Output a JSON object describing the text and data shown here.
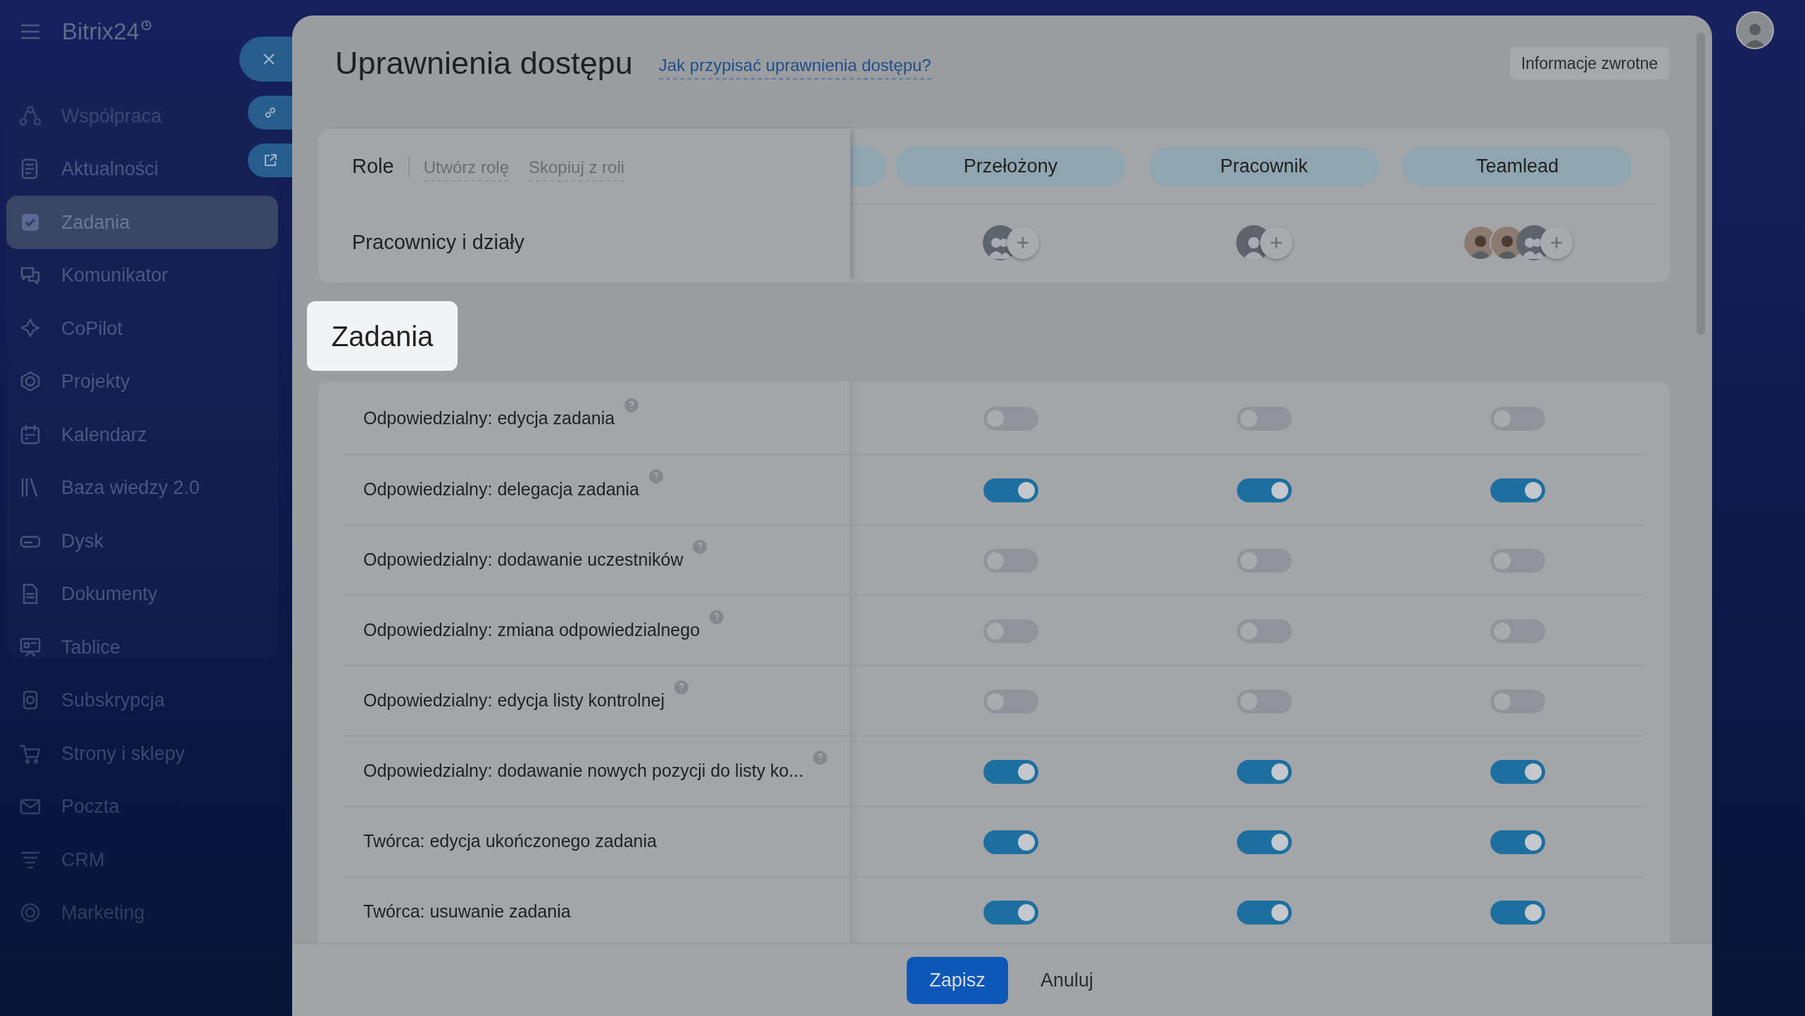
{
  "sidebar": {
    "logo": "Bitrix24",
    "items": [
      {
        "label": "Współpraca",
        "selected": false
      },
      {
        "label": "Aktualności",
        "selected": false
      },
      {
        "label": "Zadania",
        "selected": true
      },
      {
        "label": "Komunikator",
        "selected": false
      },
      {
        "label": "CoPilot",
        "selected": false
      },
      {
        "label": "Projekty",
        "selected": false
      },
      {
        "label": "Kalendarz",
        "selected": false
      },
      {
        "label": "Baza wiedzy 2.0",
        "selected": false
      },
      {
        "label": "Dysk",
        "selected": false
      },
      {
        "label": "Dokumenty",
        "selected": false
      },
      {
        "label": "Tablice",
        "selected": false
      },
      {
        "label": "Subskrypcja",
        "selected": false
      },
      {
        "label": "Strony i sklepy",
        "selected": false
      },
      {
        "label": "Poczta",
        "selected": false
      },
      {
        "label": "CRM",
        "selected": false
      },
      {
        "label": "Marketing",
        "selected": false
      }
    ]
  },
  "modal": {
    "title": "Uprawnienia dostępu",
    "help_link": "Jak przypisać uprawnienia dostępu?",
    "feedback_button": "Informacje zwrotne",
    "roles": {
      "label": "Role",
      "actions": [
        "Utwórz rolę",
        "Skopiuj z roli"
      ],
      "members_label": "Pracownicy i działy",
      "columns": [
        {
          "name": "Przełożony",
          "members": [
            {
              "kind": "group"
            }
          ]
        },
        {
          "name": "Pracownik",
          "members": [
            {
              "kind": "person"
            }
          ]
        },
        {
          "name": "Teamlead",
          "members": [
            {
              "kind": "photo"
            },
            {
              "kind": "photo"
            },
            {
              "kind": "group"
            }
          ]
        }
      ]
    },
    "section": {
      "title": "Zadania",
      "rows": [
        {
          "label": "Odpowiedzialny: edycja zadania",
          "help": true,
          "on": [
            false,
            false,
            false
          ]
        },
        {
          "label": "Odpowiedzialny: delegacja zadania",
          "help": true,
          "on": [
            true,
            true,
            true
          ]
        },
        {
          "label": "Odpowiedzialny: dodawanie uczestników",
          "help": true,
          "on": [
            false,
            false,
            false
          ]
        },
        {
          "label": "Odpowiedzialny: zmiana odpowiedzialnego",
          "help": true,
          "on": [
            false,
            false,
            false
          ]
        },
        {
          "label": "Odpowiedzialny: edycja listy kontrolnej",
          "help": true,
          "on": [
            false,
            false,
            false
          ]
        },
        {
          "label": "Odpowiedzialny: dodawanie nowych pozycji do listy ko...",
          "help": true,
          "on": [
            true,
            true,
            true
          ]
        },
        {
          "label": "Twórca: edycja ukończonego zadania",
          "help": false,
          "on": [
            true,
            true,
            true
          ]
        },
        {
          "label": "Twórca: usuwanie zadania",
          "help": false,
          "on": [
            true,
            true,
            true
          ]
        }
      ]
    },
    "footer": {
      "save": "Zapisz",
      "cancel": "Anuluj"
    }
  }
}
